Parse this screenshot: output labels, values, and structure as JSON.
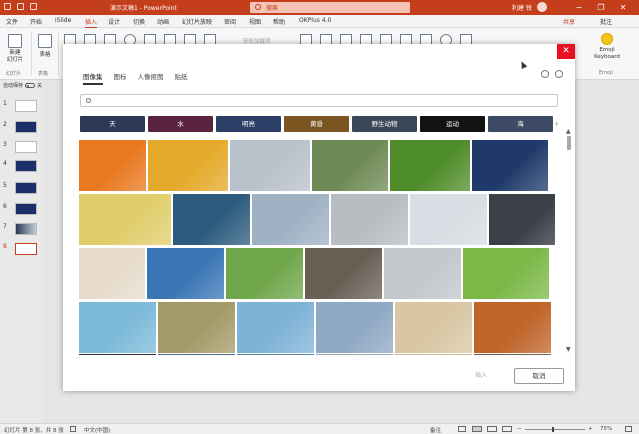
{
  "titlebar": {
    "doc_title": "演示文稿1 - PowerPoint",
    "search_placeholder": "搜索",
    "user_name": "利建 锐",
    "controls": [
      "−",
      "❐",
      "✕"
    ]
  },
  "menu": {
    "tabs": [
      "文件",
      "开始",
      "iSlide",
      "插入",
      "设计",
      "切换",
      "动画",
      "幻灯片放映",
      "审阅",
      "视图",
      "帮助",
      "OKPlus 4.0"
    ],
    "active": "插入",
    "share": "共享",
    "comments": "批注"
  },
  "ribbon": {
    "new_slide": "新建\n幻灯片",
    "table": "表格",
    "group_slides": "幻灯片",
    "group_tables": "表格",
    "emoji_label": "Emoji\nKeyboard",
    "group_emoji": "Emoji",
    "faint_text": "获取加载项"
  },
  "left_panel": {
    "auto_save": "自动保存",
    "toggle_state": "关",
    "slides": [
      "1",
      "2",
      "3",
      "4",
      "5",
      "6",
      "7",
      "8"
    ],
    "selected_slide": "8"
  },
  "dialog": {
    "tabs": [
      "图像集",
      "图标",
      "人像抠图",
      "贴纸"
    ],
    "active_tab": "图像集",
    "search_placeholder": "",
    "categories": [
      "天",
      "水",
      "明亮",
      "黄昏",
      "野生动物",
      "运动",
      "海"
    ],
    "category_colors": [
      "#2d3a55",
      "#5a2440",
      "#2b3f66",
      "#7a5520",
      "#3a4756",
      "#121212",
      "#3c4a66"
    ],
    "insert_label": "插入",
    "cancel_label": "取消",
    "close_icon": "✕",
    "photo_rows": [
      [
        "#e9781f",
        "#e4a92a",
        "#b9c1ca",
        "#6e8a54",
        "#4f8c2a",
        "#1f3a6a"
      ],
      [
        "#e0cd6a",
        "#2c5b7e",
        "#9fb2c4",
        "#b8bdc2",
        "#d7dde2",
        "#3a3f48"
      ],
      [
        "#e7dccc",
        "#3a76b6",
        "#6fa64a",
        "#6a5f55",
        "#c3c7cb",
        "#7bb847"
      ],
      [
        "#7cbad8",
        "#a49a68",
        "#7fb3d6",
        "#8fa8c4",
        "#d9c7a4",
        "#c0642a"
      ],
      [
        "#2a2f38",
        "#4e6a86",
        "#5b87a7",
        "#98a7b6",
        "#cbb79a",
        "#7c5d4a"
      ]
    ]
  },
  "statusbar": {
    "slide_info": "幻灯片 第 8 张，共 8 张",
    "language": "中文(中国)",
    "notes": "备注",
    "zoom": "75%"
  }
}
